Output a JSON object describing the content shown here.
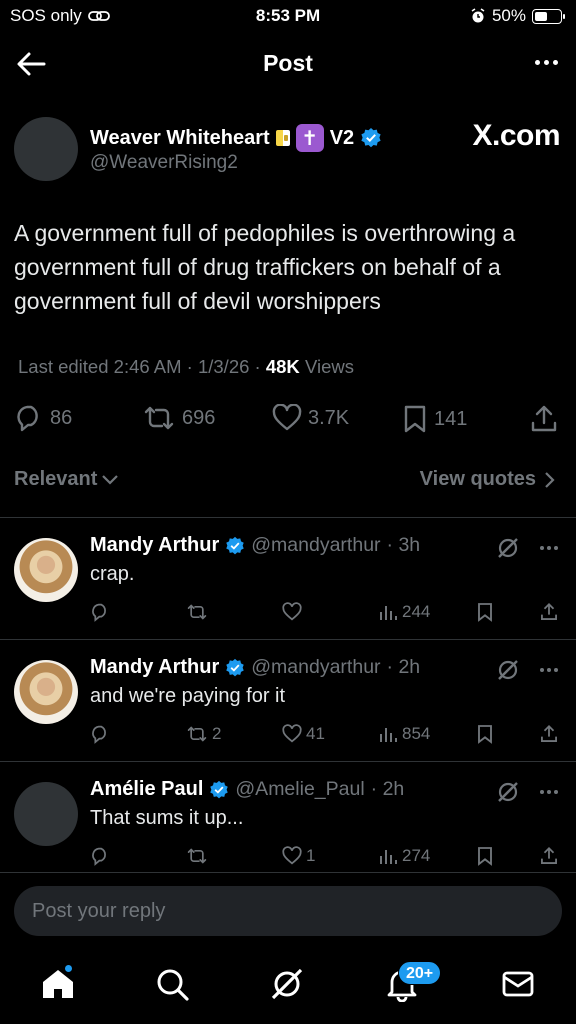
{
  "status_bar": {
    "carrier": "SOS only",
    "time": "8:53 PM",
    "battery": "50%",
    "battery_level": 0.5
  },
  "header": {
    "title": "Post"
  },
  "post": {
    "author_name": "Weaver Whiteheart",
    "author_suffix": "V2",
    "author_handle": "@WeaverRising2",
    "brand": "X.com",
    "text": "A government full of pedophiles is overthrowing a government full of drug traffickers on behalf of a government full of devil worshippers",
    "meta_prefix": "Last edited 2:46 AM · 1/3/26 · ",
    "views_count": "48K",
    "views_label": "Views",
    "replies": "86",
    "reposts": "696",
    "likes": "3.7K",
    "bookmarks": "141"
  },
  "filters": {
    "relevant": "Relevant",
    "view_quotes": "View quotes"
  },
  "replies": [
    {
      "name": "Mandy Arthur",
      "handle": "@mandyarthur",
      "time": "· 3h",
      "text": "crap.",
      "reposts": "",
      "likes": "",
      "views": "244"
    },
    {
      "name": "Mandy Arthur",
      "handle": "@mandyarthur",
      "time": "· 2h",
      "text": "and we're paying for it",
      "reposts": "2",
      "likes": "41",
      "views": "854"
    },
    {
      "name": "Amélie Paul",
      "handle": "@Amelie_Paul",
      "time": "· 2h",
      "text": "That sums it up...",
      "reposts": "",
      "likes": "1",
      "views": "274"
    }
  ],
  "composer": {
    "placeholder": "Post your reply"
  },
  "bottom_nav": {
    "notifications_badge": "20+"
  },
  "colors": {
    "accent": "#1d9bf0",
    "muted": "#71767b",
    "background": "#000000"
  }
}
